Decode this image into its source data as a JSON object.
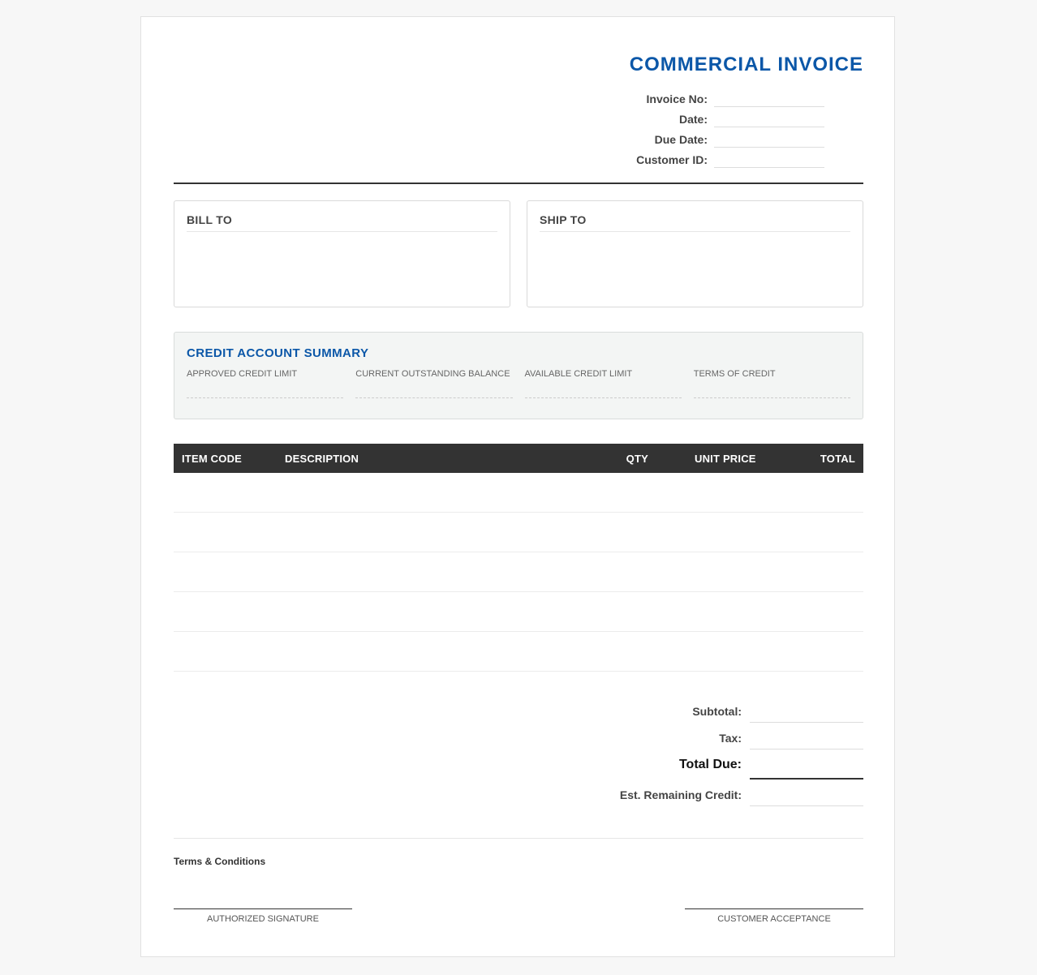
{
  "title": "COMMERCIAL INVOICE",
  "meta": [
    {
      "label": "Invoice No:",
      "value": ""
    },
    {
      "label": "Date:",
      "value": ""
    },
    {
      "label": "Due Date:",
      "value": ""
    },
    {
      "label": "Customer ID:",
      "value": ""
    }
  ],
  "bill_to": {
    "title": "BILL TO",
    "body": ""
  },
  "ship_to": {
    "title": "SHIP TO",
    "body": ""
  },
  "credit": {
    "title": "CREDIT ACCOUNT SUMMARY",
    "fields": [
      {
        "label": "APPROVED CREDIT LIMIT",
        "value": ""
      },
      {
        "label": "CURRENT OUTSTANDING BALANCE",
        "value": ""
      },
      {
        "label": "AVAILABLE CREDIT LIMIT",
        "value": ""
      },
      {
        "label": "TERMS OF CREDIT",
        "value": ""
      }
    ]
  },
  "table": {
    "headers": {
      "item_code": "ITEM CODE",
      "description": "DESCRIPTION",
      "qty": "QTY",
      "unit_price": "UNIT PRICE",
      "total": "TOTAL"
    },
    "rows": [
      {
        "item_code": "",
        "description": "",
        "qty": "",
        "unit_price": "",
        "total": ""
      },
      {
        "item_code": "",
        "description": "",
        "qty": "",
        "unit_price": "",
        "total": ""
      },
      {
        "item_code": "",
        "description": "",
        "qty": "",
        "unit_price": "",
        "total": ""
      },
      {
        "item_code": "",
        "description": "",
        "qty": "",
        "unit_price": "",
        "total": ""
      },
      {
        "item_code": "",
        "description": "",
        "qty": "",
        "unit_price": "",
        "total": ""
      }
    ]
  },
  "totals": {
    "subtotal_label": "Subtotal:",
    "subtotal": "",
    "tax_label": "Tax:",
    "tax": "",
    "total_due_label": "Total Due:",
    "total_due": "",
    "remaining_label": "Est. Remaining Credit:",
    "remaining": ""
  },
  "footer": {
    "terms": "Terms & Conditions",
    "signature_left": "AUTHORIZED SIGNATURE",
    "signature_right": "CUSTOMER ACCEPTANCE"
  },
  "colors": {
    "accent": "#0b57a8",
    "table_header_bg": "#333333",
    "credit_bg": "#f3f5f4"
  }
}
